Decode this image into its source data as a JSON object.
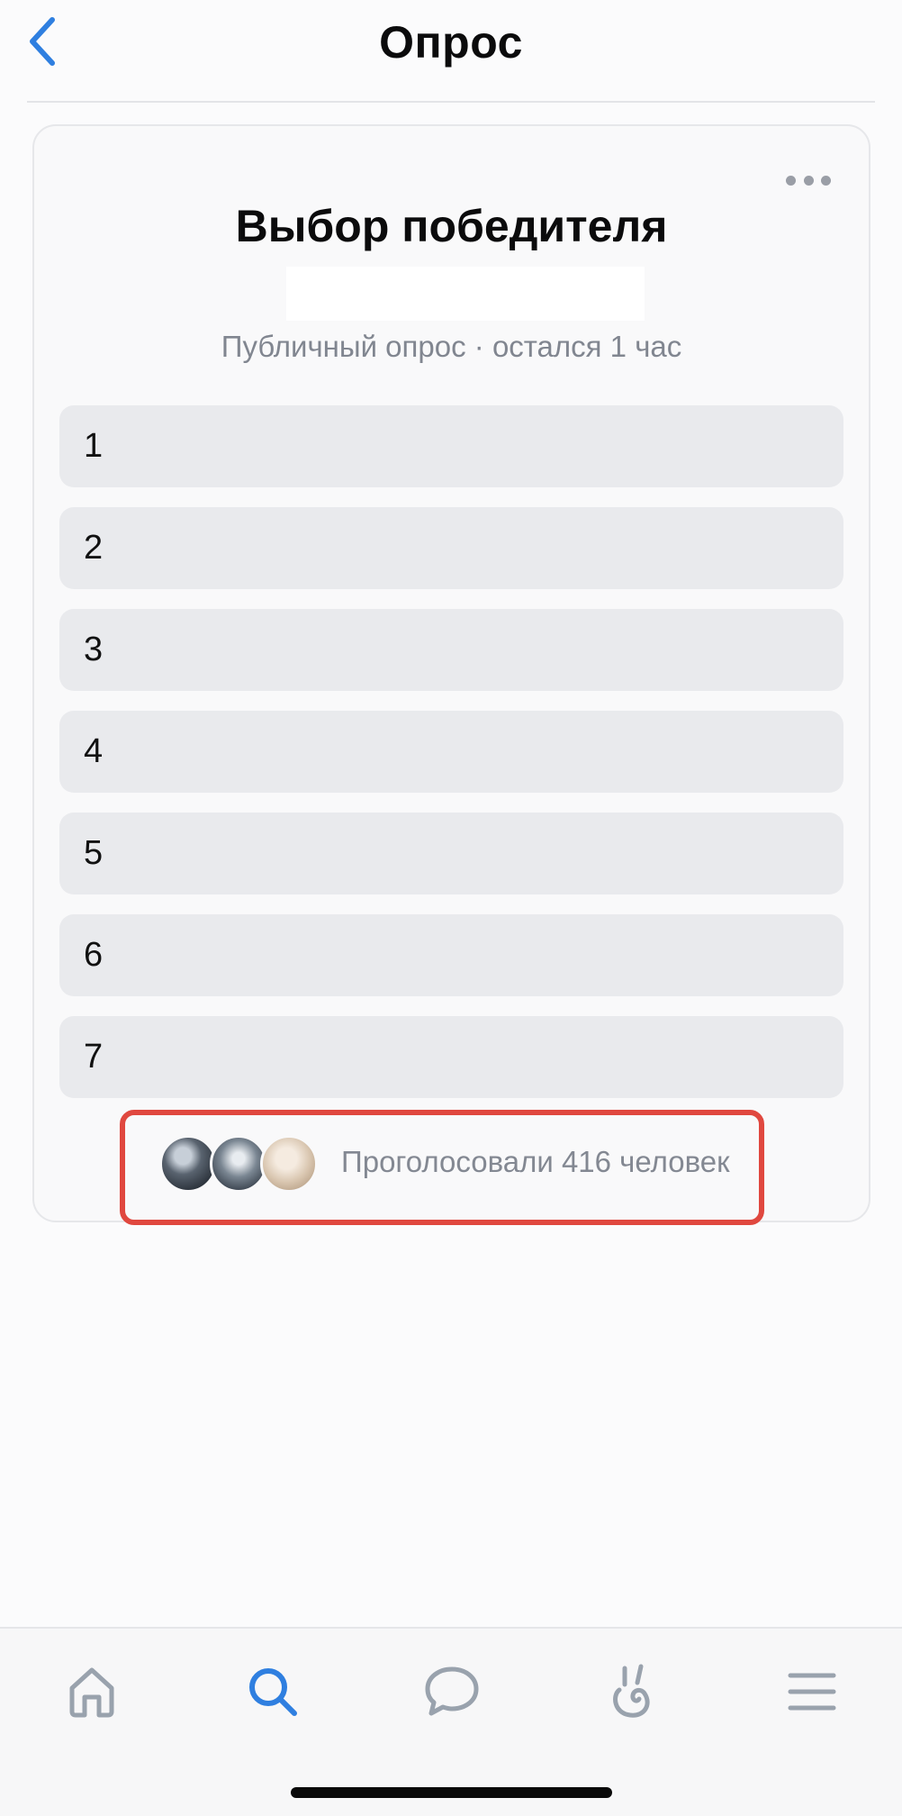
{
  "header": {
    "title": "Опрос",
    "back_icon": "chevron-left-icon",
    "accent_color": "#2f7fe0"
  },
  "poll": {
    "title": "Выбор победителя",
    "meta": "Публичный опрос · остался 1 час",
    "more_icon": "more-horizontal-icon",
    "options": [
      {
        "label": "1"
      },
      {
        "label": "2"
      },
      {
        "label": "3"
      },
      {
        "label": "4"
      },
      {
        "label": "5"
      },
      {
        "label": "6"
      },
      {
        "label": "7"
      }
    ],
    "voters": {
      "text": "Проголосовали 416 человек",
      "highlight_color": "#e0483f"
    }
  },
  "tabbar": {
    "tabs": [
      {
        "name": "home",
        "icon": "home-icon",
        "active": false
      },
      {
        "name": "search",
        "icon": "search-icon",
        "active": true
      },
      {
        "name": "messages",
        "icon": "message-bubble-icon",
        "active": false
      },
      {
        "name": "clips",
        "icon": "clips-icon",
        "active": false
      },
      {
        "name": "menu",
        "icon": "menu-icon",
        "active": false
      }
    ],
    "active_color": "#2f7fe0",
    "inactive_color": "#99a2ad"
  }
}
